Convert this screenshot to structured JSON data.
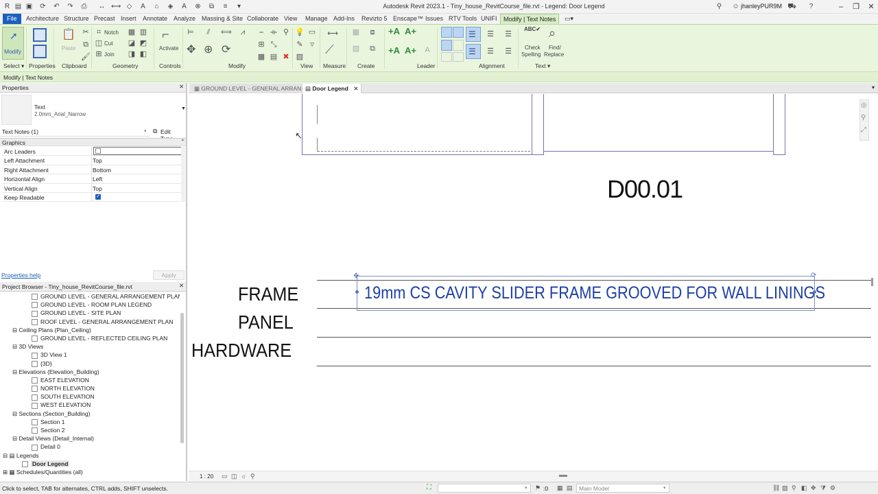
{
  "app": {
    "title": "Autodesk Revit 2023.1 - Tiny_house_RevitCourse_file.rvt - Legend: Door Legend",
    "user": "jhanleyPUR9M",
    "icons": [
      "save-icon",
      "undo-icon",
      "redo-icon",
      "print-icon",
      "measure-icon",
      "text-icon",
      "sync-icon"
    ]
  },
  "menu": {
    "file": "File",
    "tabs": [
      "Architecture",
      "Structure",
      "Precast",
      "Insert",
      "Annotate",
      "Analyze",
      "Massing & Site",
      "Collaborate",
      "View",
      "Manage",
      "Add-Ins",
      "Revizto 5",
      "Enscape™",
      "Issues",
      "RTV Tools",
      "UNIFI"
    ],
    "active_tab": "Modify | Text Notes"
  },
  "ribbon": {
    "modify": "Modify",
    "paste": "Paste",
    "notch": "Notch",
    "cut": "Cut",
    "join": "Join",
    "activate": "Activate",
    "check_spelling_1": "Check",
    "check_spelling_2": "Spelling",
    "find_replace_1": "Find/",
    "find_replace_2": "Replace",
    "panels": {
      "select": "Select",
      "properties": "Properties",
      "clipboard": "Clipboard",
      "geometry": "Geometry",
      "controls": "Controls",
      "modify": "Modify",
      "view": "View",
      "measure": "Measure",
      "create": "Create",
      "leader": "Leader",
      "alignment": "Alignment",
      "text": "Text"
    }
  },
  "context": "Modify | Text Notes",
  "properties": {
    "title": "Properties",
    "type_name": "Text",
    "type_sub": "2.0mm_Arial_Narrow",
    "selector": "Text Notes (1)",
    "edit_type": "Edit Type",
    "group": "Graphics",
    "rows": [
      {
        "k": "Arc Leaders",
        "v": ""
      },
      {
        "k": "Left Attachment",
        "v": "Top"
      },
      {
        "k": "Right Attachment",
        "v": "Bottom"
      },
      {
        "k": "Horizontal Align",
        "v": "Left"
      },
      {
        "k": "Vertical Align",
        "v": "Top"
      },
      {
        "k": "Keep Readable",
        "v": ""
      }
    ],
    "help": "Properties help",
    "apply": "Apply"
  },
  "browser": {
    "title": "Project Browser - Tiny_house_RevitCourse_file.rvt",
    "items": [
      {
        "t": "GROUND LEVEL - GENERAL ARRANGEMENT PLAN",
        "lvl": 2
      },
      {
        "t": "GROUND LEVEL - ROOM PLAN LEGEND",
        "lvl": 2
      },
      {
        "t": "GROUND LEVEL - SITE PLAN",
        "lvl": 2
      },
      {
        "t": "ROOF LEVEL - GENERAL ARRANGEMENT PLAN",
        "lvl": 2
      },
      {
        "t": "Ceiling Plans (Plan_Ceiling)",
        "lvl": 1
      },
      {
        "t": "GROUND LEVEL - REFLECTED CEILING PLAN",
        "lvl": 2
      },
      {
        "t": "3D Views",
        "lvl": 1
      },
      {
        "t": "3D View 1",
        "lvl": 2
      },
      {
        "t": "{3D}",
        "lvl": 2
      },
      {
        "t": "Elevations (Elevation_Building)",
        "lvl": 1
      },
      {
        "t": "EAST ELEVATION",
        "lvl": 2
      },
      {
        "t": "NORTH ELEVATION",
        "lvl": 2
      },
      {
        "t": "SOUTH ELEVATION",
        "lvl": 2
      },
      {
        "t": "WEST ELEVATION",
        "lvl": 2
      },
      {
        "t": "Sections (Section_Building)",
        "lvl": 1
      },
      {
        "t": "Section 1",
        "lvl": 2
      },
      {
        "t": "Section 2",
        "lvl": 2
      },
      {
        "t": "Detail Views (Detail_Internal)",
        "lvl": 1
      },
      {
        "t": "Detail 0",
        "lvl": 2
      },
      {
        "t": "Legends",
        "lvl": 0
      },
      {
        "t": "Door Legend",
        "lvl": 1
      },
      {
        "t": "Schedules/Quantities (all)",
        "lvl": 0
      }
    ]
  },
  "viewtabs": [
    {
      "label": "GROUND LEVEL - GENERAL ARRAN..."
    },
    {
      "label": "Door Legend"
    }
  ],
  "legend": {
    "door_tag": "D00.01",
    "frame": "FRAME",
    "panel": "PANEL",
    "hardware": "HARDWARE",
    "note": "19mm CS CAVITY SLIDER FRAME GROOVED FOR WALL LININGS"
  },
  "viewcontrol": {
    "scale": "1 : 20"
  },
  "status": {
    "hint": "Click to select, TAB for alternates, CTRL adds, SHIFT unselects.",
    "workset_value": ":0",
    "model": "Main Model"
  },
  "colors": {
    "accent": "#1c5fbd",
    "ribbon": "#eaf5de",
    "selection": "#1d3fa6"
  }
}
